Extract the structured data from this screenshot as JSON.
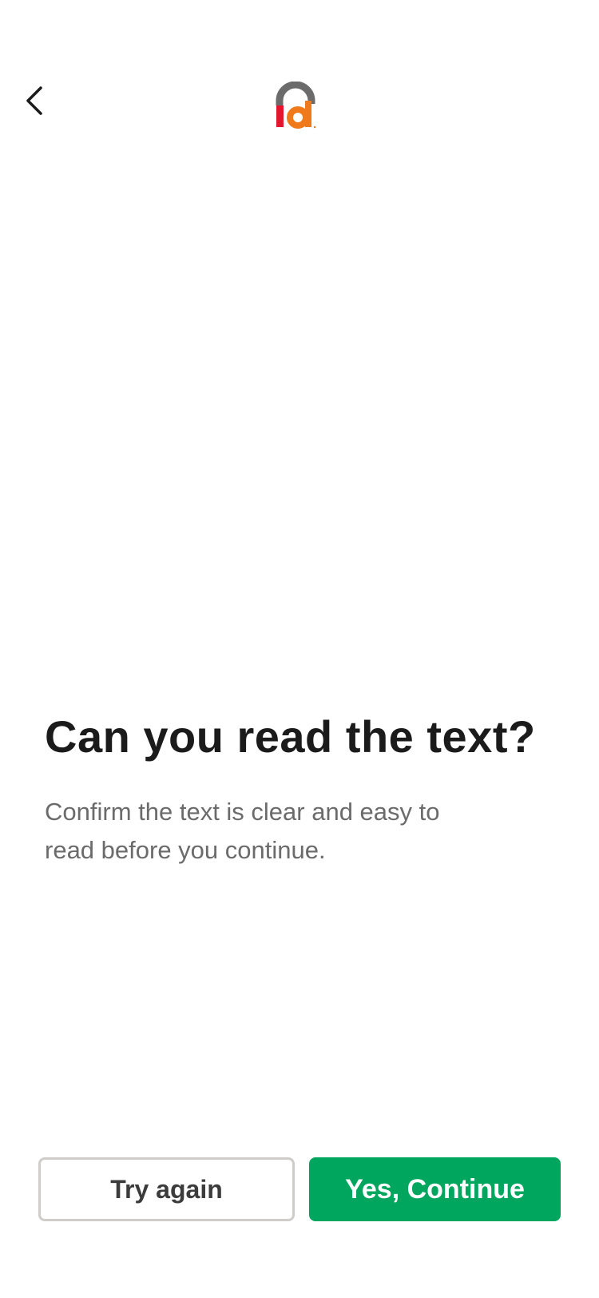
{
  "header": {
    "back_icon": "chevron-left-icon",
    "logo_icon": "id-logo-icon",
    "logo_text": "id",
    "colors": {
      "logo_arc": "#6b6b6b",
      "logo_i": "#e3162c",
      "logo_d": "#f07a1a"
    }
  },
  "main": {
    "title": "Can you read the text?",
    "subtitle": "Confirm the text is clear and easy to read before you continue."
  },
  "actions": {
    "try_again_label": "Try again",
    "continue_label": "Yes, Continue"
  },
  "colors": {
    "primary": "#00a65e",
    "secondary_border": "#cfcdc9",
    "title": "#1b1b1b",
    "subtitle": "#6b6b6b"
  }
}
